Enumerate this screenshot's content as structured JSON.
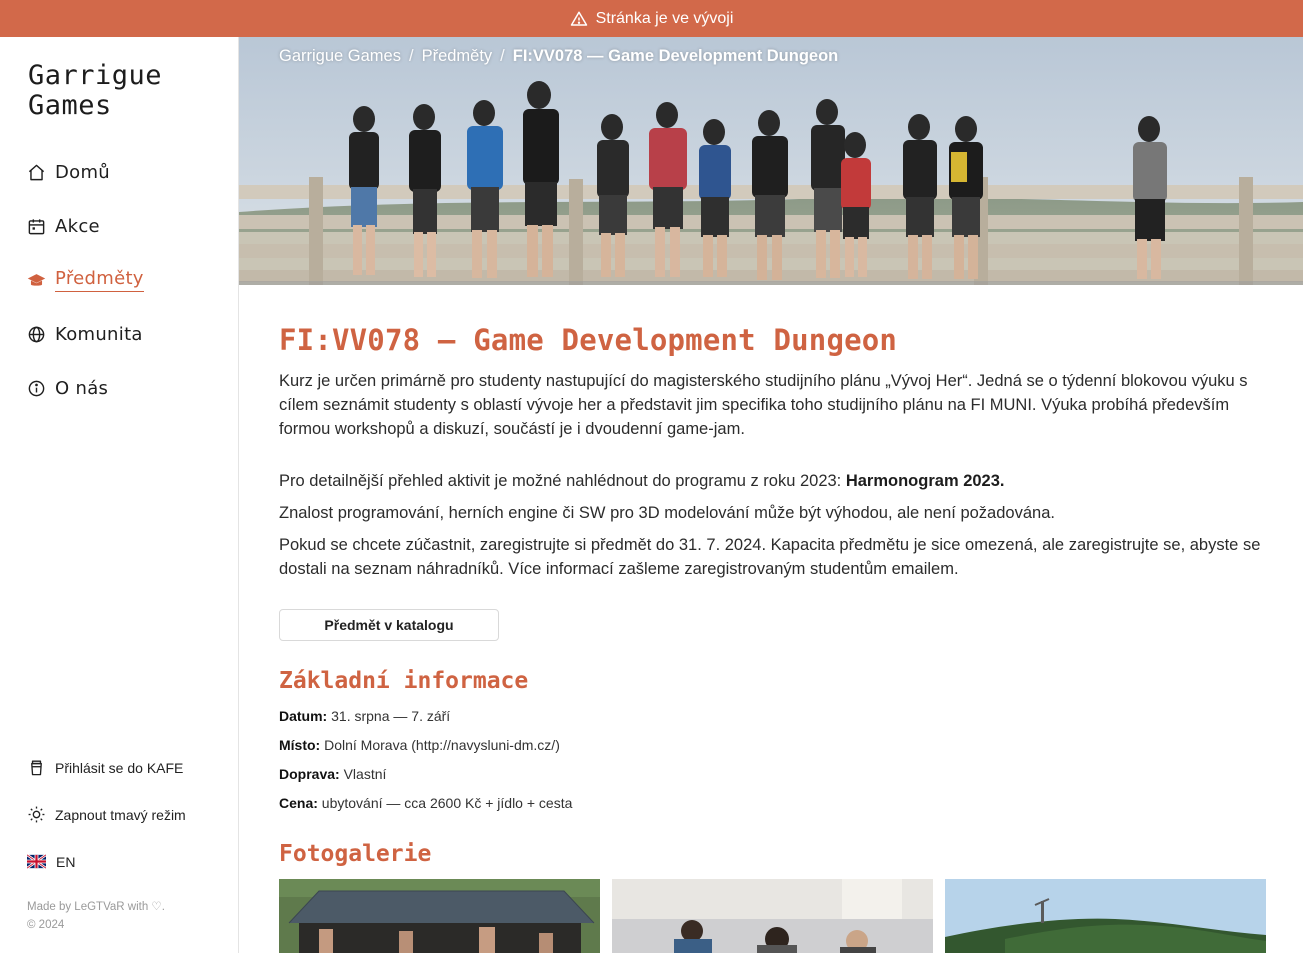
{
  "banner": {
    "text": "Stránka je ve vývoji",
    "icon": "warning-icon"
  },
  "brand": {
    "line1": "Garrigue",
    "line2": "Games"
  },
  "nav": [
    {
      "label": "Domů",
      "icon": "home-icon"
    },
    {
      "label": "Akce",
      "icon": "calendar-icon"
    },
    {
      "label": "Předměty",
      "icon": "graduation-cap-icon",
      "active": true
    },
    {
      "label": "Komunita",
      "icon": "globe-icon"
    },
    {
      "label": "O nás",
      "icon": "info-icon"
    }
  ],
  "sidebar_bottom": {
    "login": "Přihlásit se do KAFE",
    "dark_mode": "Zapnout tmavý režim",
    "language": "EN"
  },
  "footer": {
    "made_by": "Made by LeGTVaR with ♡.",
    "copyright": "© 2024"
  },
  "breadcrumb": {
    "home": "Garrigue Games",
    "section": "Předměty",
    "current": "FI:VV078 — Game Development Dungeon",
    "separator": "/"
  },
  "course": {
    "title": "FI:VV078 — Game Development Dungeon",
    "intro": "Kurz je určen primárně pro studenty nastupující do magisterského studijního plánu „Vývoj Her“. Jedná se o týdenní blokovou výuku s cílem seznámit studenty s oblastí vývoje her a představit jim specifika toho studijního plánu na FI MUNI. Výuka probíhá především formou workshopů a diskuzí, součástí je i dvoudenní game-jam.",
    "program_text": "Pro detailnější přehled aktivit je možné nahlédnout do programu z roku 2023: ",
    "program_link": "Harmonogram 2023.",
    "knowledge": "Znalost programování, herních engine či SW pro 3D modelování může být výhodou, ale není požadována.",
    "registration": "Pokud se chcete zúčastnit, zaregistrujte si předmět do 31. 7. 2024. Kapacita předmětu je sice omezená, ale zaregistrujte se, abyste se dostali na seznam náhradníků. Více informací zašleme zaregistrovaným studentům emailem.",
    "catalog_button": "Předmět v katalogu"
  },
  "basic_info": {
    "heading": "Základní informace",
    "items": [
      {
        "label": "Datum:",
        "value": "31. srpna — 7. září"
      },
      {
        "label": "Místo:",
        "value": "Dolní Morava (http://navysluni-dm.cz/)"
      },
      {
        "label": "Doprava:",
        "value": "Vlastní"
      },
      {
        "label": "Cena:",
        "value": "ubytování — cca 2600 Kč + jídlo + cesta"
      }
    ]
  },
  "gallery": {
    "heading": "Fotogalerie"
  },
  "colors": {
    "accent": "#d0613f",
    "banner": "#d2694a"
  }
}
